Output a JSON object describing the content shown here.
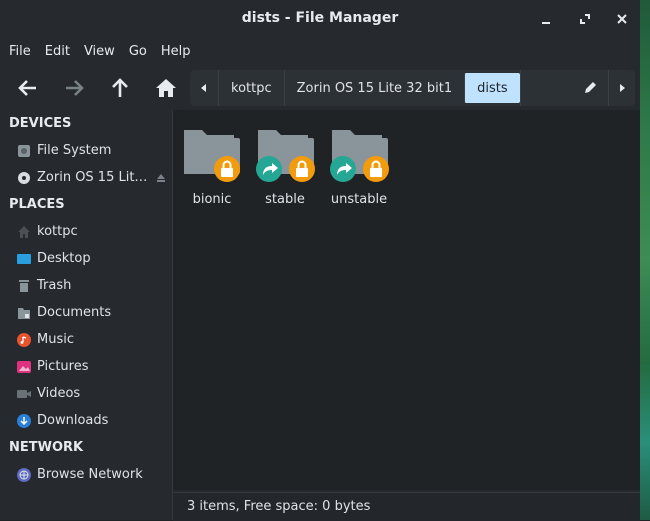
{
  "window": {
    "title": "dists - File Manager"
  },
  "menu": [
    "File",
    "Edit",
    "View",
    "Go",
    "Help"
  ],
  "pathbar": {
    "crumbs": [
      "kottpc",
      "Zorin OS 15 Lite 32 bit1",
      "dists"
    ],
    "active_index": 2
  },
  "sidebar": {
    "devices_header": "DEVICES",
    "devices": [
      {
        "label": "File System",
        "icon": "harddisk-icon"
      },
      {
        "label": "Zorin OS 15 Lit…",
        "icon": "disc-icon",
        "ejectable": true
      }
    ],
    "places_header": "PLACES",
    "places": [
      {
        "label": "kottpc",
        "icon": "home-folder-icon"
      },
      {
        "label": "Desktop",
        "icon": "desktop-icon"
      },
      {
        "label": "Trash",
        "icon": "trash-icon"
      },
      {
        "label": "Documents",
        "icon": "documents-icon"
      },
      {
        "label": "Music",
        "icon": "music-icon"
      },
      {
        "label": "Pictures",
        "icon": "pictures-icon"
      },
      {
        "label": "Videos",
        "icon": "videos-icon"
      },
      {
        "label": "Downloads",
        "icon": "downloads-icon"
      }
    ],
    "network_header": "NETWORK",
    "network": [
      {
        "label": "Browse Network",
        "icon": "network-icon"
      }
    ]
  },
  "files": [
    {
      "name": "bionic",
      "emblems": [
        "lock"
      ]
    },
    {
      "name": "stable",
      "emblems": [
        "symlink",
        "lock"
      ]
    },
    {
      "name": "unstable",
      "emblems": [
        "symlink",
        "lock"
      ]
    }
  ],
  "status": "3 items, Free space: 0 bytes",
  "colors": {
    "accent": "#bfe3ff",
    "lock_emblem": "#f29b0c",
    "link_emblem": "#26a695",
    "folder": "#8a949b"
  }
}
